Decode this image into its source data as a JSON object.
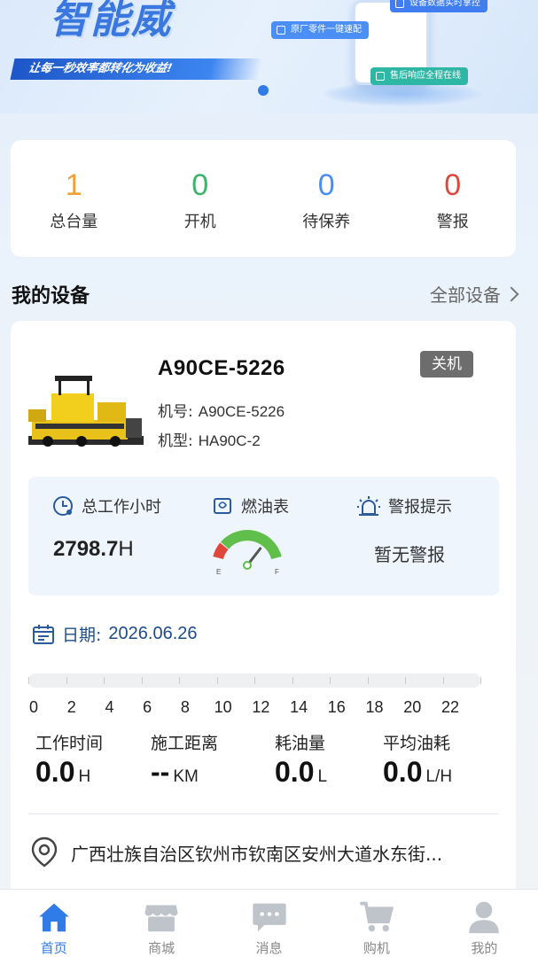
{
  "banner": {
    "title": "智能威",
    "slogan": "让每一秒效率都转化为收益!",
    "chips": [
      "设备数据实时掌控",
      "原厂零件一键速配",
      "售后响应全程在线"
    ]
  },
  "stats": [
    {
      "value": "1",
      "label": "总台量",
      "color": "#f0a23a"
    },
    {
      "value": "0",
      "label": "开机",
      "color": "#3bb36a"
    },
    {
      "value": "0",
      "label": "待保养",
      "color": "#4a8ff0"
    },
    {
      "value": "0",
      "label": "警报",
      "color": "#e0463c"
    }
  ],
  "section": {
    "title": "我的设备",
    "link": "全部设备"
  },
  "device": {
    "name": "A90CE-5226",
    "status": "关机",
    "machine_no_label": "机号:",
    "machine_no": "A90CE-5226",
    "model_label": "机型:",
    "model": "HA90C-2",
    "hours_label": "总工作小时",
    "hours_value": "2798.7",
    "hours_unit": "H",
    "fuel_label": "燃油表",
    "fuel_level": 0.75,
    "fuel_empty": "E",
    "fuel_full": "F",
    "alarm_label": "警报提示",
    "alarm_value": "暂无警报",
    "date_label": "日期:",
    "date_value": "2026.06.26",
    "timeline_labels": [
      "0",
      "2",
      "4",
      "6",
      "8",
      "10",
      "12",
      "14",
      "16",
      "18",
      "20",
      "22"
    ],
    "daily": [
      {
        "label": "工作时间",
        "value": "0.0",
        "unit": "H"
      },
      {
        "label": "施工距离",
        "value": "--",
        "unit": "KM"
      },
      {
        "label": "耗油量",
        "value": "0.0",
        "unit": "L"
      },
      {
        "label": "平均油耗",
        "value": "0.0",
        "unit": "L/H"
      }
    ],
    "address": "广西壮族自治区钦州市钦南区安州大道水东街..."
  },
  "tabs": [
    {
      "label": "首页",
      "icon": "home-icon",
      "active": true
    },
    {
      "label": "商城",
      "icon": "store-icon",
      "active": false
    },
    {
      "label": "消息",
      "icon": "message-icon",
      "active": false
    },
    {
      "label": "购机",
      "icon": "cart-icon",
      "active": false
    },
    {
      "label": "我的",
      "icon": "user-icon",
      "active": false
    }
  ],
  "colors": {
    "accent": "#2f7be8",
    "inactive_tab": "#bfc4cb",
    "gauge_green": "#5fbf4a",
    "gauge_red": "#e0463c"
  }
}
